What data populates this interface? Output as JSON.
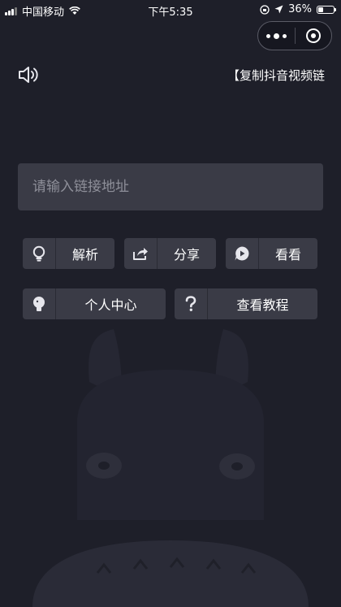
{
  "status_bar": {
    "carrier": "中国移动",
    "time": "下午5:35",
    "battery": "36%",
    "battery_level": 0.36
  },
  "capsule": {
    "more_icon": "more-dots-icon",
    "close_icon": "close-circle-icon"
  },
  "header": {
    "sound_icon": "speaker-icon",
    "marquee_text": "【复制抖音视频链"
  },
  "input": {
    "placeholder": "请输入链接地址",
    "value": ""
  },
  "buttons": {
    "parse": {
      "label": "解析",
      "icon": "lightbulb-icon"
    },
    "share": {
      "label": "分享",
      "icon": "share-icon"
    },
    "watch": {
      "label": "看看",
      "icon": "play-icon"
    },
    "profile": {
      "label": "个人中心",
      "icon": "user-icon"
    },
    "tutorial": {
      "label": "查看教程",
      "icon": "question-icon"
    }
  },
  "colors": {
    "background": "#1e1f29",
    "button": "#3a3b46",
    "text": "#ffffff"
  }
}
